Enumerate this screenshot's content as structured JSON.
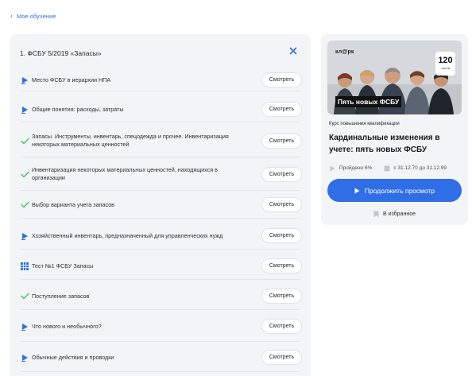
{
  "nav": {
    "back_label": "Мое обучение"
  },
  "module": {
    "title": "1. ФСБУ 5/2019 «Запасы»",
    "lessons": [
      {
        "icon": "video-play-icon",
        "text": "Место ФСБУ в иерархии НПА",
        "button": "Смотреть"
      },
      {
        "icon": "video-play-icon",
        "text": "Общие понятия: расходы, затраты",
        "button": "Смотреть"
      },
      {
        "icon": "checkmark-icon",
        "text": "Запасы. Инструменты, инвентарь, спецодежда и прочее. Инвентаризация некоторых материальных ценностей",
        "button": "Смотреть"
      },
      {
        "icon": "checkmark-icon",
        "text": "Инвентаризация некоторых материальных ценностей, находящихся в организации",
        "button": "Смотреть"
      },
      {
        "icon": "checkmark-icon",
        "text": "Выбор варианта учета запасов",
        "button": "Смотреть"
      },
      {
        "icon": "video-play-icon",
        "text": "Хозяйственный инвентарь, предназначенный для управленческих нужд",
        "button": "Смотреть"
      },
      {
        "icon": "test-grid-icon",
        "text": "Тест №1 ФСБУ Запасы",
        "button": "Смотреть"
      },
      {
        "icon": "checkmark-icon",
        "text": "Поступление запасов",
        "button": "Смотреть"
      },
      {
        "icon": "video-play-icon",
        "text": "Что нового и необычного?",
        "button": "Смотреть"
      },
      {
        "icon": "video-play-icon",
        "text": "Обычные действия и проводки",
        "button": "Смотреть"
      }
    ]
  },
  "course": {
    "cover_brand": "кл@рк",
    "cover_hours_number": "120",
    "cover_hours_unit": "часов",
    "cover_title": "Пять новых ФСБУ",
    "type_label": "Курс повышения квалификации",
    "name": "Кардинальные изменения в учете: пять новых ФСБУ",
    "progress_text": "Пройдено 6%",
    "progress_percent": 6,
    "period_text": "с 31.12.70 до 31.12.99",
    "continue_label": "Продолжить просмотр",
    "favorite_label": "В избранное"
  },
  "colors": {
    "accent": "#2f6ee6",
    "link": "#3b6fe0",
    "check": "#3fbf6a",
    "panel_bg": "#f3f4f6"
  }
}
